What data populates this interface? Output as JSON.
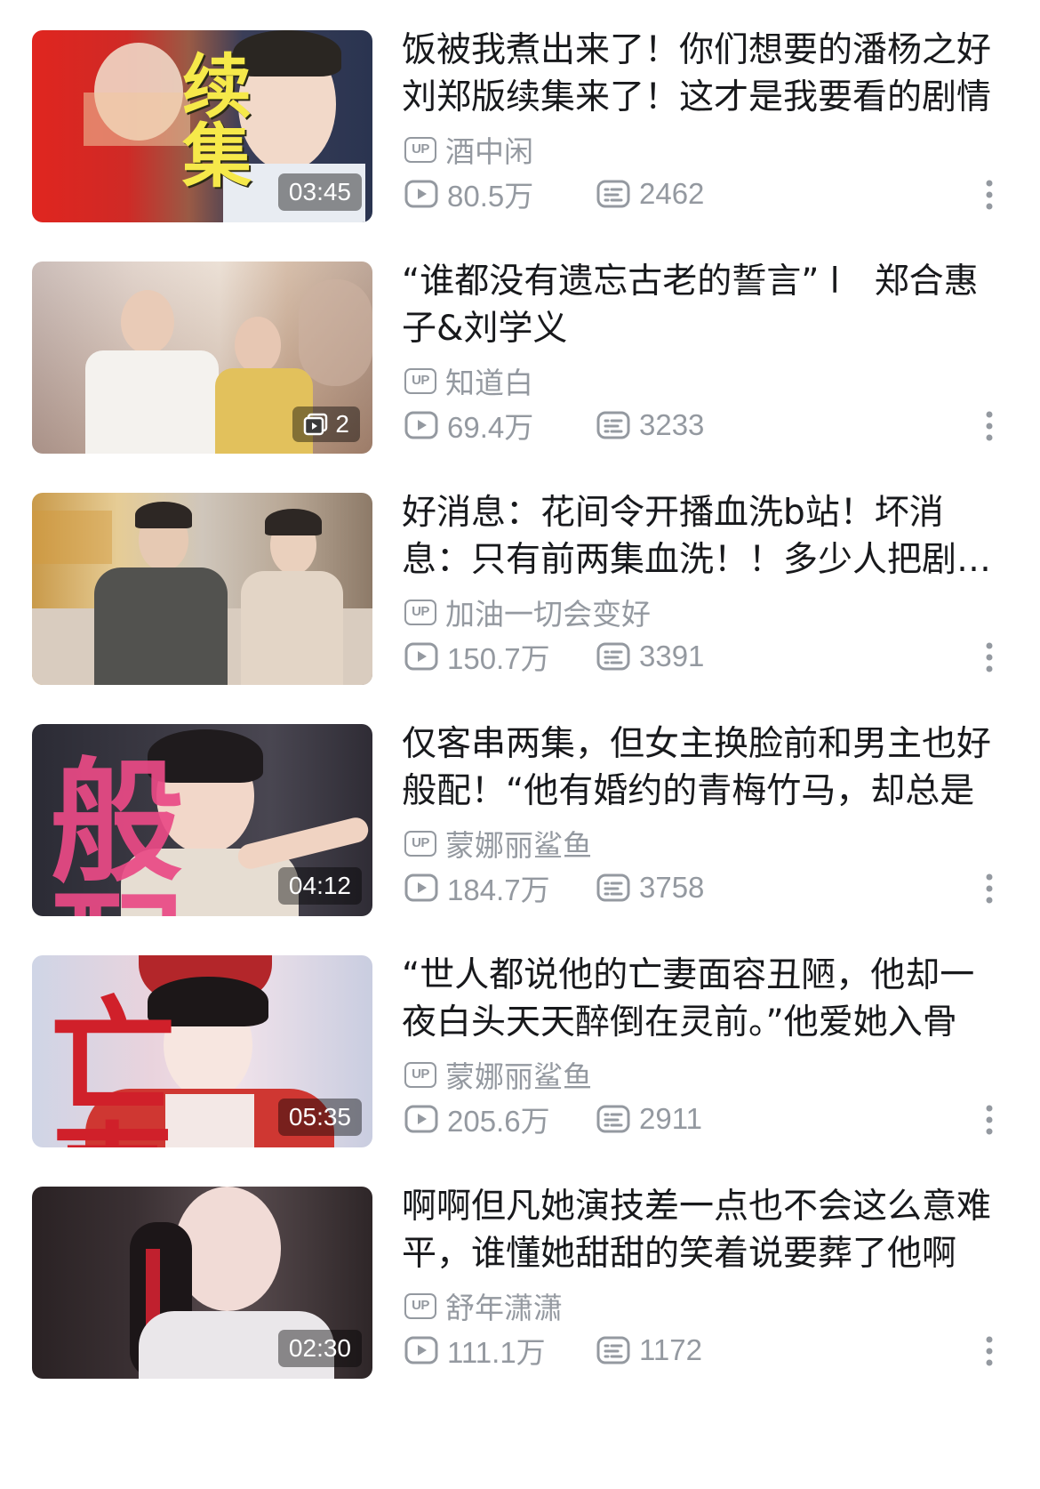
{
  "feed": {
    "items": [
      {
        "title": "饭被我煮出来了！你们想要的潘杨之好刘郑版续集来了！这才是我要看的剧情",
        "uploader": "酒中闲",
        "views": "80.5万",
        "danmaku": "2462",
        "badge": "03:45",
        "thumb_text": "续集"
      },
      {
        "title": "“谁都没有遗忘古老的誓言” l　郑合惠子&刘学义",
        "uploader": "知道白",
        "views": "69.4万",
        "danmaku": "3233",
        "badge": "2",
        "thumb_text": ""
      },
      {
        "title": "好消息：花间令开播血洗b站！坏消息：只有前两集血洗！！多少人把剧看完了",
        "uploader": "加油一切会变好",
        "views": "150.7万",
        "danmaku": "3391",
        "badge": "",
        "thumb_text": ""
      },
      {
        "title": "仅客串两集，但女主换脸前和男主也好般配！“他有婚约的青梅竹马，却总是",
        "uploader": "蒙娜丽鲨鱼",
        "views": "184.7万",
        "danmaku": "3758",
        "badge": "04:12",
        "thumb_text": "般配"
      },
      {
        "title": "“世人都说他的亡妻面容丑陋，他却一夜白头天天醉倒在灵前。”他爱她入骨",
        "uploader": "蒙娜丽鲨鱼",
        "views": "205.6万",
        "danmaku": "2911",
        "badge": "05:35",
        "thumb_text": "亡妻"
      },
      {
        "title": "啊啊但凡她演技差一点也不会这么意难平，谁懂她甜甜的笑着说要葬了他啊",
        "uploader": "舒年潇潇",
        "views": "111.1万",
        "danmaku": "1172",
        "badge": "02:30",
        "thumb_text": ""
      }
    ]
  },
  "labels": {
    "up_icon": "UP"
  },
  "colors": {
    "title_text": "#18191c",
    "meta_text": "#9499a0",
    "background": "#ffffff"
  },
  "icons": {
    "uploader": "up-icon",
    "views": "play-count-icon",
    "danmaku": "danmaku-icon",
    "more": "more-vertical-icon",
    "multi_part": "multi-part-icon"
  }
}
